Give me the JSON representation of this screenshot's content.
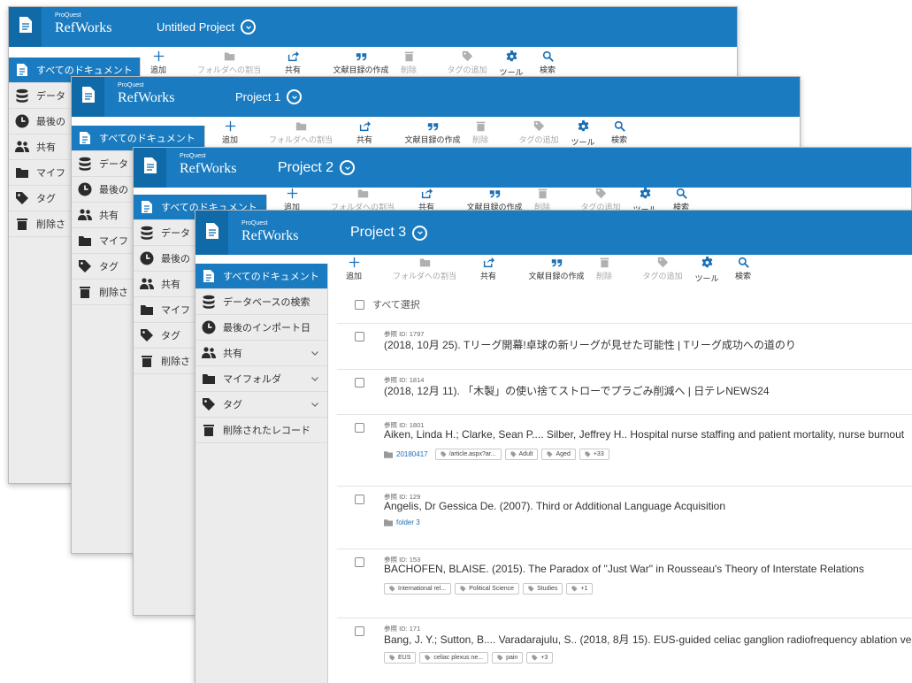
{
  "app": {
    "brand_small": "ProQuest",
    "brand_name": "RefWorks"
  },
  "windows": [
    {
      "project_title": "Untitled Project"
    },
    {
      "project_title": "Project 1"
    },
    {
      "project_title": "Project 2"
    },
    {
      "project_title": "Project 3"
    }
  ],
  "toolbar": {
    "items": [
      {
        "label": "追加",
        "icon": "plus-icon",
        "enabled": true
      },
      {
        "label": "フォルダへの割当",
        "icon": "folder-icon",
        "enabled": false
      },
      {
        "label": "共有",
        "icon": "share-icon",
        "enabled": true
      },
      {
        "label": "文献目録の作成",
        "icon": "quote-icon",
        "enabled": true
      },
      {
        "label": "削除",
        "icon": "trash-icon",
        "enabled": false
      },
      {
        "label": "タグの追加",
        "icon": "tag-icon",
        "enabled": false
      },
      {
        "label": "ツール",
        "icon": "gear-icon",
        "enabled": true
      },
      {
        "label": "検索",
        "icon": "search-icon",
        "enabled": true
      }
    ]
  },
  "sidebar": {
    "items": [
      {
        "label": "すべてのドキュメント",
        "icon": "document-icon",
        "active": true
      },
      {
        "label": "データベースの検索",
        "icon": "database-icon"
      },
      {
        "label": "最後のインポート日",
        "icon": "clock-icon"
      },
      {
        "label": "共有",
        "icon": "users-icon",
        "expandable": true
      },
      {
        "label": "マイフォルダ",
        "icon": "folder-icon",
        "expandable": true
      },
      {
        "label": "タグ",
        "icon": "tag-icon",
        "expandable": true
      },
      {
        "label": "削除されたレコード",
        "icon": "trash-icon"
      }
    ],
    "truncated": [
      "すべてのドキュメント",
      "データ",
      "最後の",
      "共有",
      "マイフ",
      "タグ",
      "削除さ"
    ]
  },
  "main": {
    "select_all_label": "すべて選択",
    "documents": [
      {
        "ref_id": "参照 ID: 1797",
        "title": "(2018, 10月 25). Tリーグ開幕!卓球の新リーグが見せた可能性 | Tリーグ成功への道のり"
      },
      {
        "ref_id": "参照 ID: 1814",
        "title": "(2018, 12月 11). 「木製」の使い捨てストローでプラごみ削減へ | 日テレNEWS24"
      },
      {
        "ref_id": "参照 ID: 1801",
        "title": "Aiken, Linda H.; Clarke, Sean P.... Silber, Jeffrey H.. Hospital nurse staffing and patient mortality, nurse burnout",
        "folder": "20180417",
        "tags": [
          "/article.aspx?ar...",
          "Adult",
          "Aged",
          "+33"
        ]
      },
      {
        "ref_id": "参照 ID: 129",
        "title": "Angelis, Dr Gessica De. (2007). Third or Additional Language Acquisition",
        "folder": "folder 3"
      },
      {
        "ref_id": "参照 ID: 153",
        "title": "BACHOFEN, BLAISE. (2015). The Paradox of \"Just War\" in Rousseau's Theory of Interstate Relations",
        "tags": [
          "International rel...",
          "Political Science",
          "Studies",
          "+1"
        ]
      },
      {
        "ref_id": "参照 ID: 171",
        "title": "Bang, J. Y.; Sutton, B.... Varadarajulu, S.. (2018, 8月 15). EUS-guided celiac ganglion radiofrequency ablation ve",
        "tags": [
          "EUS",
          "celiac plexus ne...",
          "pain",
          "+3"
        ]
      }
    ]
  },
  "colors": {
    "header": "#1a7bc0",
    "doc_button": "#106aa8",
    "sidebar_bg": "#ececec",
    "link": "#1a6fb5"
  }
}
